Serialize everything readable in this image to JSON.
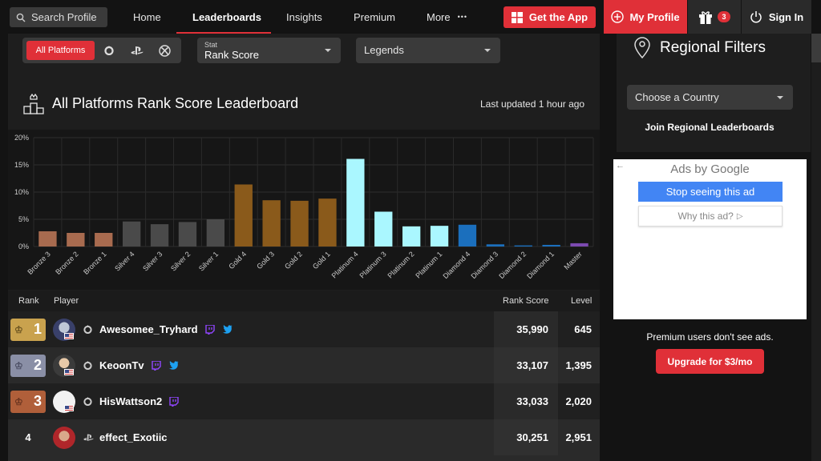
{
  "nav": {
    "search_placeholder": "Search Profile",
    "links": [
      "Home",
      "Leaderboards",
      "Insights",
      "Premium",
      "More"
    ],
    "more_dots": "•••",
    "get_app": "Get the App",
    "my_profile": "My Profile",
    "gift_count": "3",
    "sign_in": "Sign In",
    "accent_color": "#e03038"
  },
  "filters": {
    "all_platforms": "All Platforms",
    "platform_icons": [
      "origin-icon",
      "playstation-icon",
      "xbox-icon"
    ],
    "stat_label": "Stat",
    "stat_value": "Rank Score",
    "legend_value": "Legends"
  },
  "leaderboard": {
    "title": "All Platforms Rank Score Leaderboard",
    "updated": "Last updated 1 hour ago"
  },
  "chart_data": {
    "type": "bar",
    "categories": [
      "Bronze 3",
      "Bronze 2",
      "Bronze 1",
      "Silver 4",
      "Silver 3",
      "Silver 2",
      "Silver 1",
      "Gold 4",
      "Gold 3",
      "Gold 2",
      "Gold 1",
      "Platinum 4",
      "Platinum 3",
      "Platinum 2",
      "Platinum 1",
      "Diamond 4",
      "Diamond 3",
      "Diamond 2",
      "Diamond 1",
      "Master"
    ],
    "values": [
      2.8,
      2.5,
      2.5,
      4.6,
      4.1,
      4.5,
      5.0,
      11.4,
      8.5,
      8.4,
      8.8,
      16.1,
      6.4,
      3.7,
      3.8,
      4.0,
      0.4,
      0.2,
      0.3,
      0.6
    ],
    "colors": [
      "#a86b4f",
      "#a86b4f",
      "#a86b4f",
      "#4a4a4a",
      "#4a4a4a",
      "#4a4a4a",
      "#4a4a4a",
      "#8a5a1b",
      "#8a5a1b",
      "#8a5a1b",
      "#8a5a1b",
      "#aaf7ff",
      "#aaf7ff",
      "#aaf7ff",
      "#aaf7ff",
      "#1b6fbd",
      "#1b6fbd",
      "#1b6fbd",
      "#1b6fbd",
      "#7c4ab0"
    ],
    "ylim": [
      0,
      20
    ],
    "yticks": [
      "0%",
      "5%",
      "10%",
      "15%",
      "20%"
    ],
    "grid": true
  },
  "table": {
    "headers": {
      "rank": "Rank",
      "player": "Player",
      "score": "Rank Score",
      "level": "Level"
    },
    "rows": [
      {
        "rank": "1",
        "name": "Awesomee_Tryhard",
        "platform": "origin-icon",
        "score": "35,990",
        "level": "645",
        "medal": "#c9a24e",
        "twitch": true,
        "twitter": true
      },
      {
        "rank": "2",
        "name": "KeoonTv",
        "platform": "origin-icon",
        "score": "33,107",
        "level": "1,395",
        "medal": "#8a8fa6",
        "twitch": true,
        "twitter": true
      },
      {
        "rank": "3",
        "name": "HisWattson2",
        "platform": "origin-icon",
        "score": "33,033",
        "level": "2,020",
        "medal": "#b05f3a",
        "twitch": true,
        "twitter": false
      },
      {
        "rank": "4",
        "name": "effect_Exotiic",
        "platform": "playstation-icon",
        "score": "30,251",
        "level": "2,951",
        "medal": "",
        "twitch": false,
        "twitter": false
      }
    ]
  },
  "sidebar": {
    "regional_title": "Regional Filters",
    "country_placeholder": "Choose a Country",
    "join": "Join Regional Leaderboards",
    "ads_by": "Ads by Google",
    "stop_ad": "Stop seeing this ad",
    "why_ad": "Why this ad?",
    "premium_note": "Premium users don't see ads.",
    "upgrade": "Upgrade for $3/mo"
  }
}
